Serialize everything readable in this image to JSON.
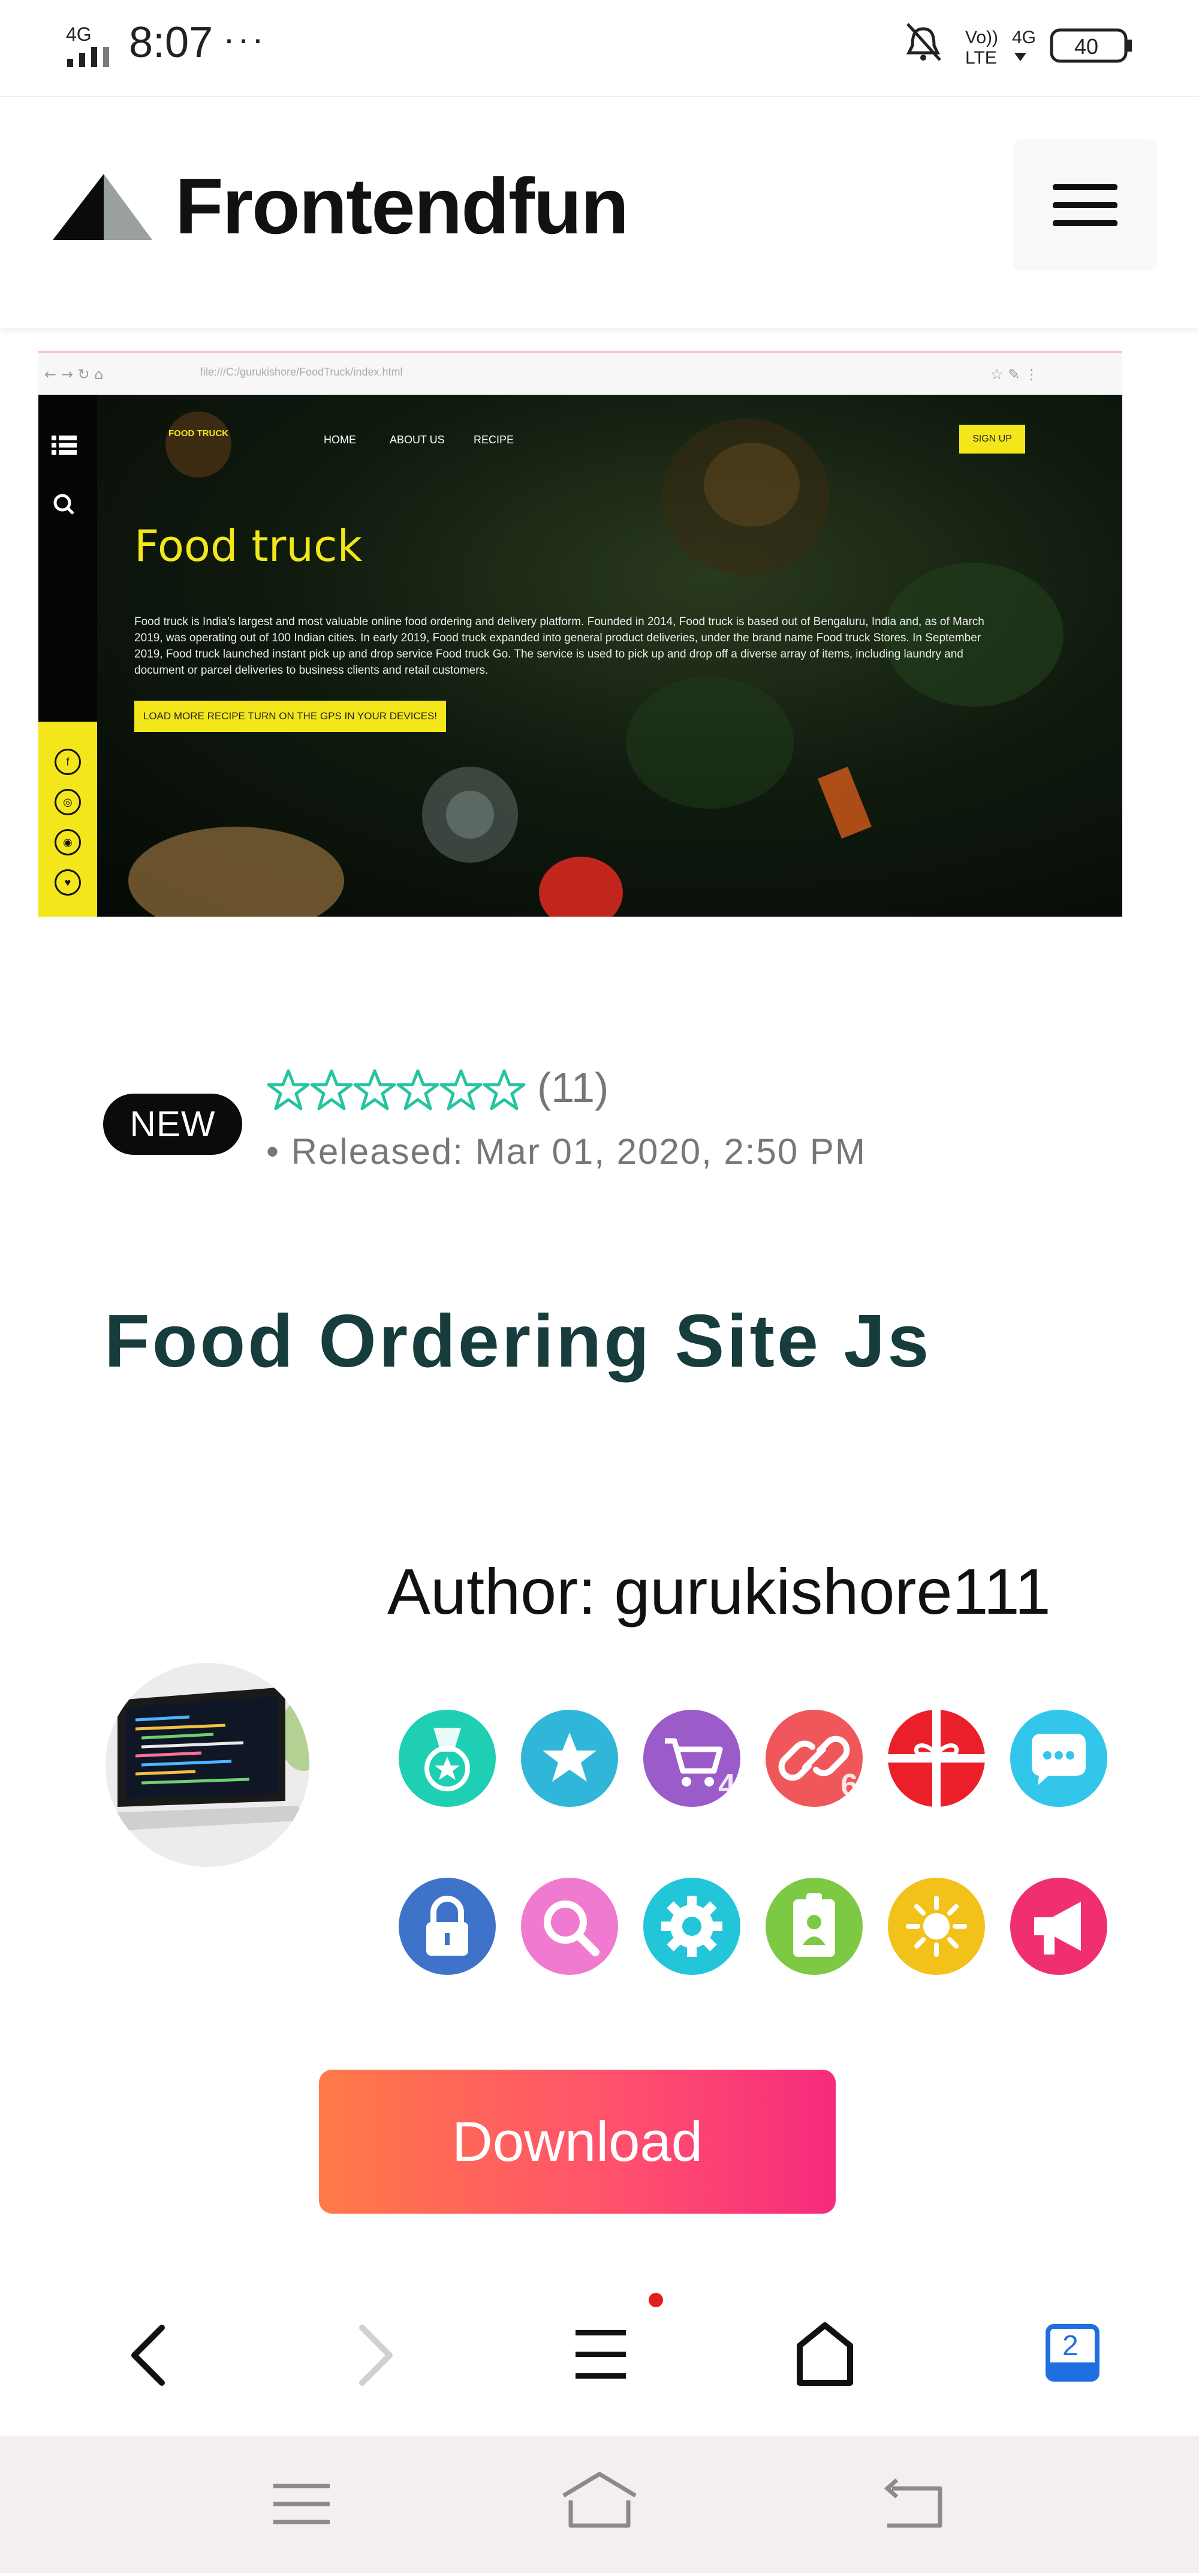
{
  "status_bar": {
    "network": "4G",
    "time": "8:07",
    "dots": "···",
    "volte": "Vo))",
    "lte": "LTE",
    "net_right": "4G",
    "battery": "40"
  },
  "header": {
    "brand": "Frontendfun",
    "menu_icon": "hamburger-menu-icon"
  },
  "preview": {
    "url": "file:///C:/gurukishore/FoodTruck/index.html",
    "site_title": "Food truck",
    "nav": [
      "HOME",
      "ABOUT US",
      "RECIPE"
    ],
    "signup": "SIGN UP",
    "logo": "FOOD TRUCK",
    "description": "Food truck is India's largest and most valuable online food ordering and delivery platform. Founded in 2014, Food truck is based out of Bengaluru, India and, as of March 2019, was operating out of 100 Indian cities. In early 2019, Food truck expanded into general product deliveries, under the brand name Food truck Stores. In September 2019, Food truck launched instant pick up and drop service Food truck Go. The service is used to pick up and drop off a diverse array of items, including laundry and document or parcel deliveries to business clients and retail customers.",
    "cta": "LOAD MORE RECIPE TURN ON THE GPS IN YOUR DEVICES!",
    "social": [
      "f",
      "◎",
      "◉",
      "♥"
    ]
  },
  "meta": {
    "badge": "NEW",
    "rating": {
      "stars_filled": 0,
      "stars_total": 6,
      "count": "(11)"
    },
    "released": "• Released: Mar 01, 2020, 2:50 PM"
  },
  "post": {
    "title": "Food Ordering Site Js",
    "author": "Author: gurukishore111"
  },
  "badges": [
    {
      "icon": "medal-icon",
      "color": "#1fcfb4",
      "count": ""
    },
    {
      "icon": "star-icon",
      "color": "#2fb6d8",
      "count": ""
    },
    {
      "icon": "cart-icon",
      "color": "#9b5cc9",
      "count": "4"
    },
    {
      "icon": "link-icon",
      "color": "#f0575a",
      "count": "6"
    },
    {
      "icon": "gift-icon",
      "color": "#ea1f2a",
      "count": ""
    },
    {
      "icon": "chat-icon",
      "color": "#31c6ea",
      "count": ""
    },
    {
      "icon": "lock-icon",
      "color": "#3e73c9",
      "count": ""
    },
    {
      "icon": "search-icon",
      "color": "#f07ad0",
      "count": ""
    },
    {
      "icon": "gear-icon",
      "color": "#22c6d8",
      "count": ""
    },
    {
      "icon": "id-badge-icon",
      "color": "#7dc943",
      "count": ""
    },
    {
      "icon": "sun-icon",
      "color": "#f2c21b",
      "count": ""
    },
    {
      "icon": "megaphone-icon",
      "color": "#ef2f72",
      "count": ""
    }
  ],
  "download": {
    "label": "Download"
  },
  "browser_nav": {
    "tab_count": "2",
    "items": [
      "back-icon",
      "forward-icon",
      "menu-icon",
      "home-icon",
      "tabs-icon"
    ]
  },
  "system_nav": {
    "items": [
      "recent-apps-icon",
      "home-icon",
      "back-icon"
    ]
  }
}
